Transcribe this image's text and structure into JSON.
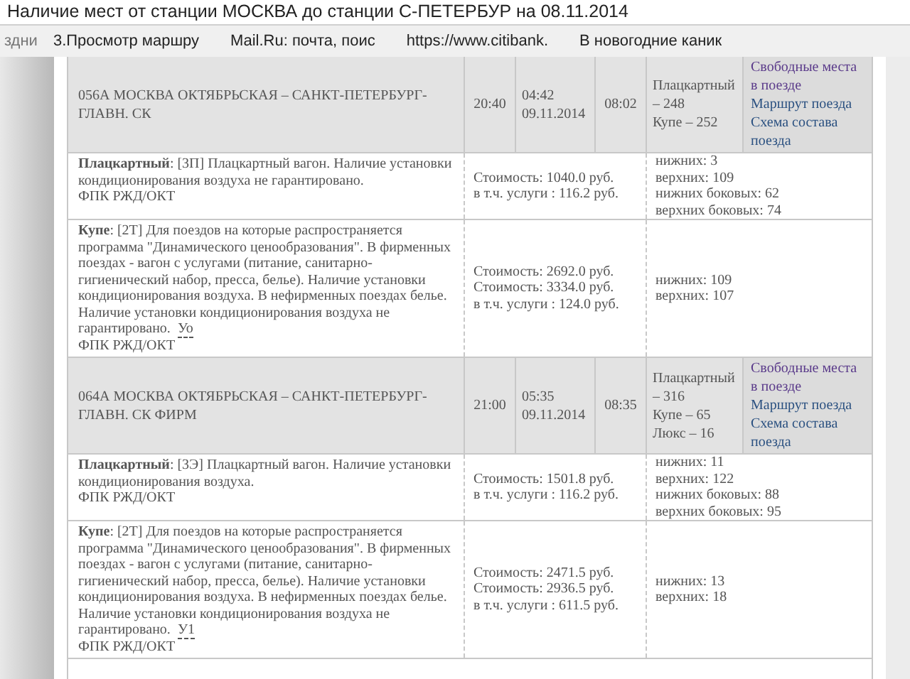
{
  "window": {
    "title": "Наличие мест от станции МОСКВА до станции С-ПЕТЕРБУР на 08.11.2014"
  },
  "bookmarks": [
    "здни",
    "3.Просмотр маршру",
    "Mail.Ru: почта, поис",
    "https://www.citibank.",
    "В новогодние каник"
  ],
  "trains": [
    {
      "name": "056А МОСКВА ОКТЯБРЬСКАЯ – САНКТ-ПЕТЕРБУРГ-ГЛАВН. СК",
      "departure": "20:40",
      "arrival_time": "04:42",
      "arrival_date": "09.11.2014",
      "travel_time": "08:02",
      "seats": [
        "Плацкартный – 248",
        "Купе – 252"
      ],
      "links": [
        "Свободные места в поезде",
        "Маршрут поезда",
        "Схема состава поезда"
      ],
      "cars": [
        {
          "description": "**Плацкартный**: [3П] Плацкартный вагон. Наличие установки кондиционирования воздуха не гарантировано.",
          "carrier": "ФПК РЖД/ОКТ",
          "costs": [
            "Стоимость: 1040.0 руб.",
            "в т.ч. услуги : 116.2 руб."
          ],
          "places": [
            "нижних: 3",
            "верхних: 109",
            "нижних боковых: 62",
            "верхних боковых: 74"
          ]
        },
        {
          "description": "**Купе**: [2Т] Для поездов на которые распространяется программа \"Динамического ценообразования\". В фирменных поездах - вагон с услугами (питание, санитарно-гигиенический набор, пресса, белье). Наличие установки кондиционирования воздуха. В нефирменных поездах белье. Наличие установки кондиционирования воздуха не гарантировано.",
          "note": "Уо",
          "carrier": "ФПК РЖД/ОКТ",
          "costs": [
            "Стоимость: 2692.0 руб.",
            "Стоимость: 3334.0 руб.",
            "в т.ч. услуги : 124.0 руб."
          ],
          "places": [
            "нижних: 109",
            "верхних: 107"
          ]
        }
      ]
    },
    {
      "name": "064А МОСКВА ОКТЯБРЬСКАЯ – САНКТ-ПЕТЕРБУРГ-ГЛАВН. СК ФИРМ",
      "departure": "21:00",
      "arrival_time": "05:35",
      "arrival_date": "09.11.2014",
      "travel_time": "08:35",
      "seats": [
        "Плацкартный – 316",
        "Купе – 65",
        "Люкс – 16"
      ],
      "links": [
        "Свободные места в поезде",
        "Маршрут поезда",
        "Схема состава поезда"
      ],
      "cars": [
        {
          "description": "**Плацкартный**: [3Э] Плацкартный вагон. Наличие установки кондиционирования воздуха.",
          "carrier": "ФПК РЖД/ОКТ",
          "costs": [
            "Стоимость: 1501.8 руб.",
            "в т.ч. услуги : 116.2 руб."
          ],
          "places": [
            "нижних: 11",
            "верхних: 122",
            "нижних боковых: 88",
            "верхних боковых: 95"
          ]
        },
        {
          "description": "**Купе**: [2Т] Для поездов на которые распространяется программа \"Динамического ценообразования\". В фирменных поездах - вагон с услугами (питание, санитарно-гигиенический набор, пресса, белье). Наличие установки кондиционирования воздуха. В нефирменных поездах белье. Наличие установки кондиционирования воздуха не гарантировано.",
          "note": "У1",
          "carrier": "ФПК РЖД/ОКТ",
          "costs": [
            "Стоимость: 2471.5 руб.",
            "Стоимость: 2936.5 руб.",
            "в т.ч. услуги : 611.5 руб."
          ],
          "places": [
            "нижних: 13",
            "верхних: 18"
          ]
        }
      ]
    }
  ]
}
